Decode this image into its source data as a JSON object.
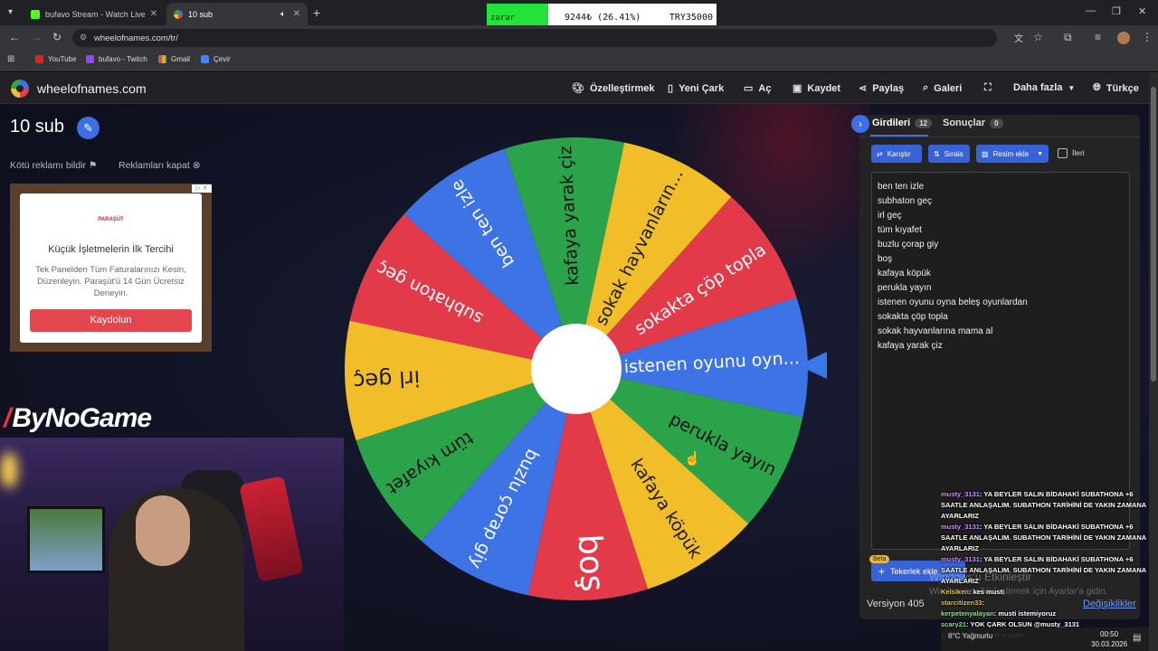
{
  "browser": {
    "tabs": [
      {
        "title": "bufavo Stream - Watch Live on",
        "icon_color": "#53fc18"
      },
      {
        "title": "10 sub",
        "icon_color": "#e43f4b"
      }
    ],
    "url": "wheelofnames.com/tr/",
    "bookmarks": [
      "YouTube",
      "bufavo - Twitch",
      "Gmail",
      "Çevir"
    ]
  },
  "stock_widget": {
    "label": "zarar",
    "value": "9244₺ (26.41%)",
    "total": "TRY35000"
  },
  "site": {
    "name": "wheelofnames.com",
    "menu": [
      "Özelleştirmek",
      "Yeni Çark",
      "Aç",
      "Kaydet",
      "Paylaş",
      "Galeri",
      "Daha fazla",
      "Türkçe"
    ]
  },
  "page": {
    "title": "10 sub",
    "report_ad": "Kötü reklamı bildir",
    "close_ads": "Reklamları kapat"
  },
  "ad": {
    "brand": "PARAŞÜT",
    "headline": "Küçük İşletmelerin İlk Tercihi",
    "body": "Tek Panelden Tüm Faturalarınızı Kesin, Düzenleyin. Paraşüt'ü 14 Gün Ücretsiz Deneyin.",
    "button": "Kaydolun"
  },
  "overlay": {
    "brand": "ByNoGame"
  },
  "wheel": {
    "segments": [
      {
        "label": "istenen oyunu oyn...",
        "color": "#3e73e6"
      },
      {
        "label": "perukla yayın",
        "color": "#2ba34a"
      },
      {
        "label": "kafaya köpük",
        "color": "#f1be2a"
      },
      {
        "label": "boş",
        "color": "#e23a48"
      },
      {
        "label": "buzlu çorap giy",
        "color": "#3e73e6"
      },
      {
        "label": "tüm kıyafet",
        "color": "#2ba34a"
      },
      {
        "label": "irl geç",
        "color": "#f1be2a"
      },
      {
        "label": "subhaton geç",
        "color": "#e23a48"
      },
      {
        "label": "ben ten izle",
        "color": "#3e73e6"
      },
      {
        "label": "kafaya yarak çiz",
        "color": "#2ba34a"
      },
      {
        "label": "sokak hayvanların...",
        "color": "#f1be2a"
      },
      {
        "label": "sokakta çöp topla",
        "color": "#e23a48"
      }
    ],
    "rotation_deg": -3
  },
  "panel": {
    "tab_entries": "Girdileri",
    "entries_count": "12",
    "tab_results": "Sonuçlar",
    "results_count": "0",
    "shuffle": "Karıştır",
    "sort": "Sırala",
    "add_image": "Resim ekle",
    "advanced": "İleri",
    "entries": [
      "ben ten izle",
      "subhaton geç",
      "irl geç",
      "tüm kıyafet",
      "buzlu çorap giy",
      "boş",
      "kafaya köpük",
      "perukla yayın",
      "istenen oyunu oyna beleş oyunlardan",
      "sokakta çöp topla",
      "sokak hayvanlarına mama al",
      "kafaya yarak çiz"
    ],
    "beta": "Beta",
    "add_wheel": "Tekerlek ekle",
    "version": "Versiyon 405",
    "changes": "Değişiklikler"
  },
  "windows_watermark": {
    "line1": "Windows'u Etkinleştir",
    "line2": "Windows'u etkinleştirmek için Ayarlar'a gidin."
  },
  "chat": [
    {
      "user": "musty_3131",
      "msg": ": YA BEYLER SALIN BİDAHAKİ SUBATHONA +6 SAATLE ANLAŞALIM. SUBATHON TARİHİNİ DE YAKIN ZAMANA AYARLARIZ"
    },
    {
      "user": "musty_3131",
      "msg": ": YA BEYLER SALIN BİDAHAKİ SUBATHONA +6 SAATLE ANLAŞALIM. SUBATHON TARİHİNİ DE YAKIN ZAMANA AYARLARIZ"
    },
    {
      "user": "musty_3131",
      "msg": ": YA BEYLER SALIN BİDAHAKİ SUBATHONA +6 SAATLE ANLAŞALIM. SUBATHON TARİHİNİ DE YAKIN ZAMANA AYARLARIZ"
    },
    {
      "user": "Kelsiken",
      "msg": ": kes musti"
    },
    {
      "user": "starcitizen33",
      "msg": ":"
    },
    {
      "user": "kerpetenyalayan",
      "msg": ": musti istemiyoruz"
    },
    {
      "user": "scary21",
      "msg": ": YOK ÇARK OLSUN @musty_3131"
    },
    {
      "user": "Kelsiken",
      "msg": ": çevircek o çarkı"
    }
  ],
  "taskbar": {
    "weather": "8°C Yağmurlu",
    "time": "00:50",
    "date": "30.03.2026"
  }
}
